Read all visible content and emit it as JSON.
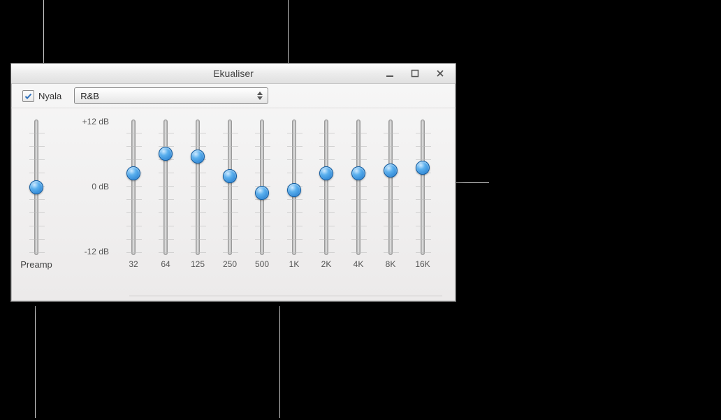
{
  "window": {
    "title": "Ekualiser",
    "buttons": {
      "minimize": "minimize",
      "maximize": "maximize",
      "close": "close"
    }
  },
  "toolbar": {
    "on_checkbox": {
      "label": "Nyala",
      "checked": true
    },
    "preset": {
      "selected": "R&B"
    }
  },
  "scale": {
    "max": "+12 dB",
    "mid": "0 dB",
    "min": "-12 dB"
  },
  "preamp": {
    "label": "Preamp",
    "value_db": 0
  },
  "bands": [
    {
      "freq": "32",
      "value_db": 2.5
    },
    {
      "freq": "64",
      "value_db": 6.0
    },
    {
      "freq": "125",
      "value_db": 5.5
    },
    {
      "freq": "250",
      "value_db": 2.0
    },
    {
      "freq": "500",
      "value_db": -1.0
    },
    {
      "freq": "1K",
      "value_db": -0.5
    },
    {
      "freq": "2K",
      "value_db": 2.5
    },
    {
      "freq": "4K",
      "value_db": 2.5
    },
    {
      "freq": "8K",
      "value_db": 3.0
    },
    {
      "freq": "16K",
      "value_db": 3.5
    }
  ],
  "colors": {
    "thumb_accent": "#1c74c9"
  },
  "chart_data": {
    "type": "bar",
    "title": "Ekualiser",
    "categories": [
      "32",
      "64",
      "125",
      "250",
      "500",
      "1K",
      "2K",
      "4K",
      "8K",
      "16K"
    ],
    "values": [
      2.5,
      6.0,
      5.5,
      2.0,
      -1.0,
      -0.5,
      2.5,
      2.5,
      3.0,
      3.5
    ],
    "xlabel": "",
    "ylabel": "dB",
    "ylim": [
      -12,
      12
    ]
  }
}
